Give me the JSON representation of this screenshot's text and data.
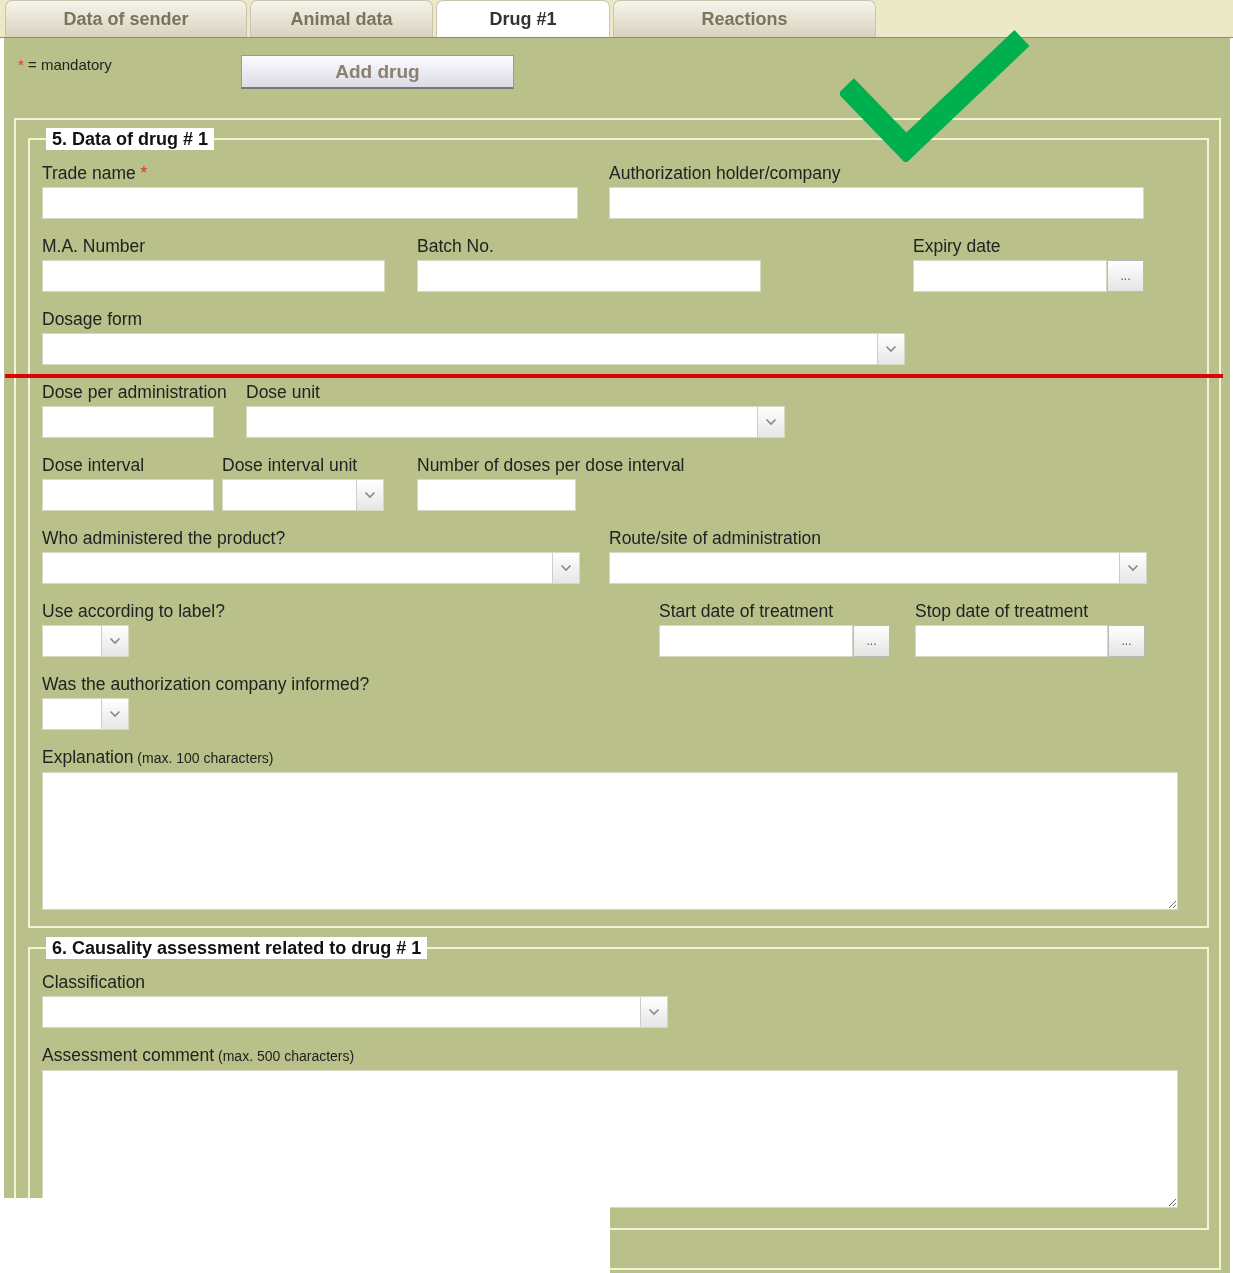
{
  "tabs": [
    {
      "label": "Data of sender",
      "selected": false
    },
    {
      "label": "Animal data",
      "selected": false
    },
    {
      "label": "Drug #1",
      "selected": true
    },
    {
      "label": "Reactions",
      "selected": false
    }
  ],
  "legend": {
    "mark": "*",
    "text": "= mandatory"
  },
  "add_button": "Add drug",
  "sections": [
    {
      "title": "5. Data of drug # 1",
      "rows": [
        [
          {
            "label": "Trade name",
            "mark": "*",
            "kind": "text"
          },
          {
            "label": "Authorization holder/company",
            "kind": "text"
          }
        ],
        [
          {
            "label": "M.A. Number",
            "kind": "text"
          },
          {
            "label": "Batch No.",
            "kind": "text"
          },
          {
            "label": "Expiry date",
            "kind": "date",
            "button": "..."
          }
        ],
        [
          {
            "label": "Dosage form",
            "kind": "select"
          }
        ],
        [
          {
            "label": "Dose per administration",
            "kind": "text"
          },
          {
            "label": "Dose unit",
            "kind": "select"
          }
        ],
        [
          {
            "label": "Dose interval",
            "kind": "text"
          },
          {
            "label": "Dose interval unit",
            "kind": "select"
          },
          {
            "label": "Number of doses per dose interval",
            "kind": "text"
          }
        ],
        [
          {
            "label": "Who administered the product?",
            "kind": "select"
          },
          {
            "label": "Route/site of administration",
            "kind": "select"
          }
        ],
        [
          {
            "label": "Use according to label?",
            "kind": "select"
          },
          {
            "label": "Start date of treatment",
            "kind": "date",
            "button": "..."
          },
          {
            "label": "Stop date of treatment",
            "kind": "date",
            "button": "..."
          }
        ],
        [
          {
            "label": "Was the authorization company informed?",
            "kind": "select"
          }
        ],
        [
          {
            "label": "Explanation",
            "hint": "(max. 100 characters)",
            "kind": "textarea"
          }
        ]
      ]
    },
    {
      "title": "6. Causality assessment related to drug # 1",
      "rows": [
        [
          {
            "label": "Classification",
            "kind": "select"
          }
        ],
        [
          {
            "label": "Assessment comment",
            "hint": "(max. 500 characters)",
            "kind": "textarea"
          }
        ]
      ]
    }
  ]
}
